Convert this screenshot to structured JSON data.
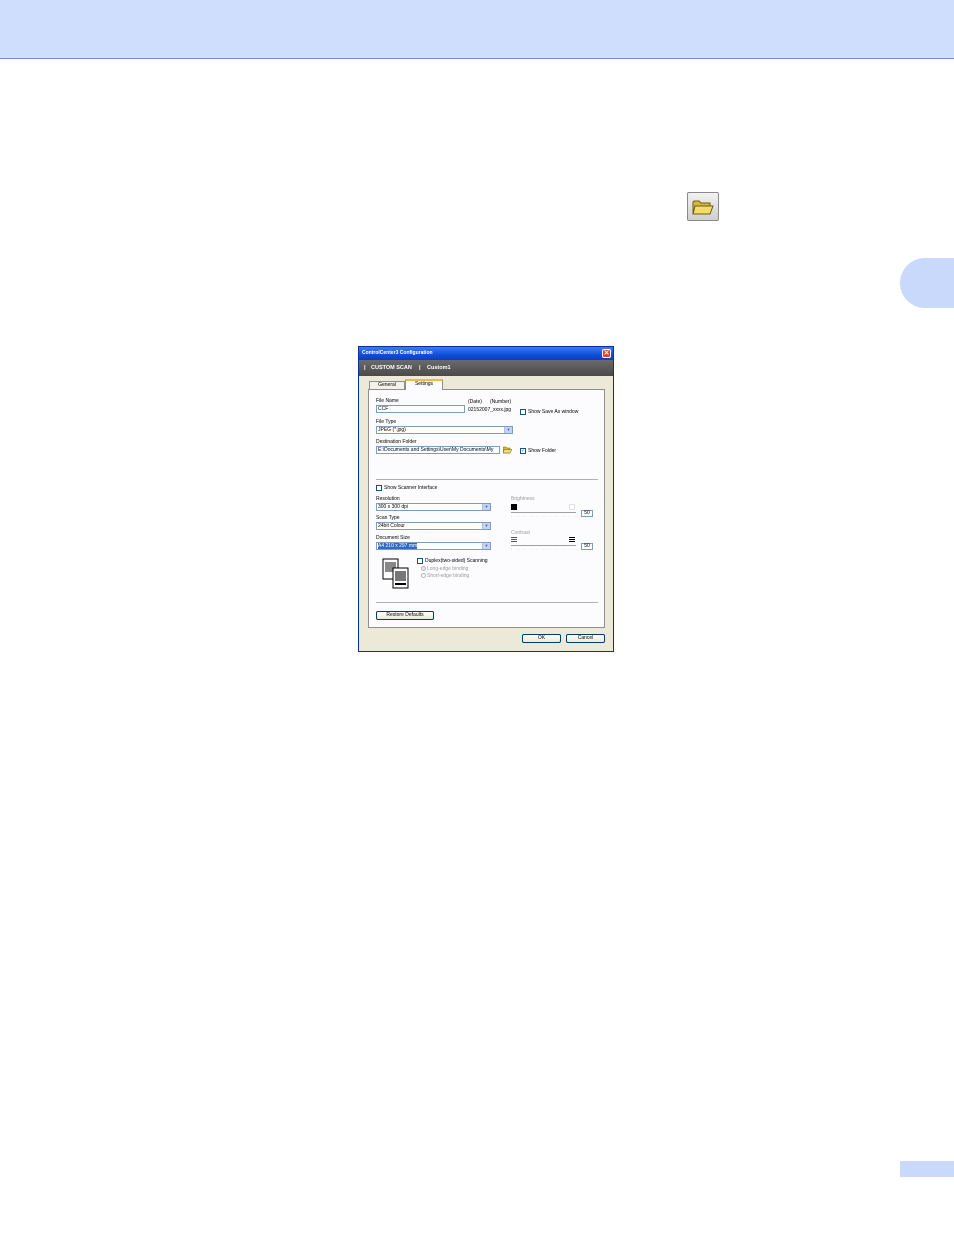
{
  "dialog": {
    "title": "ControlCenter3 Configuration",
    "banner": {
      "separator": "|",
      "section": "CUSTOM SCAN",
      "item": "Custom1"
    },
    "tabs": [
      {
        "label": "General",
        "active": false
      },
      {
        "label": "Settings",
        "active": true
      }
    ],
    "file_name": {
      "label": "File Name",
      "value": "CCF",
      "date_label": "(Date)",
      "number_label": "(Number)",
      "preview": "02152007_xxxx.jpg"
    },
    "show_save_as": {
      "label": "Show Save As window",
      "checked": false
    },
    "file_type": {
      "label": "File Type",
      "value": "JPEG (*.jpg)"
    },
    "destination": {
      "label": "Destination Folder",
      "value": "E:\\Documents and Settings\\User\\My Documents\\My"
    },
    "show_folder": {
      "label": "Show Folder",
      "checked": true
    },
    "show_scanner": {
      "label": "Show Scanner Interface",
      "checked": false
    },
    "resolution": {
      "label": "Resolution",
      "value": "300 x 300 dpi"
    },
    "scan_type": {
      "label": "Scan Type",
      "value": "24bit Colour"
    },
    "document_size": {
      "label": "Document Size",
      "value": "A4 210 x 297 mm"
    },
    "brightness": {
      "label": "Brightness",
      "value": "50"
    },
    "contrast": {
      "label": "Contrast",
      "value": "50"
    },
    "duplex": {
      "label": "Duplex(two-sided) Scanning",
      "checked": false
    },
    "binding": [
      {
        "label": "Long-edge binding",
        "selected": true
      },
      {
        "label": "Short-edge binding",
        "selected": false
      }
    ],
    "buttons": {
      "restore": "Restore Defaults",
      "ok": "OK",
      "cancel": "Cancel"
    },
    "close_glyph": "✕",
    "check_glyph": "✓",
    "arrow_glyph": "▼",
    "ticks": "· · · · · · · · · · ·"
  },
  "colors": {
    "header_band": "#cfdefc",
    "title_bar": "#0f4fd6",
    "banner": "#555555",
    "active_tab_accent": "#f6b73c"
  }
}
